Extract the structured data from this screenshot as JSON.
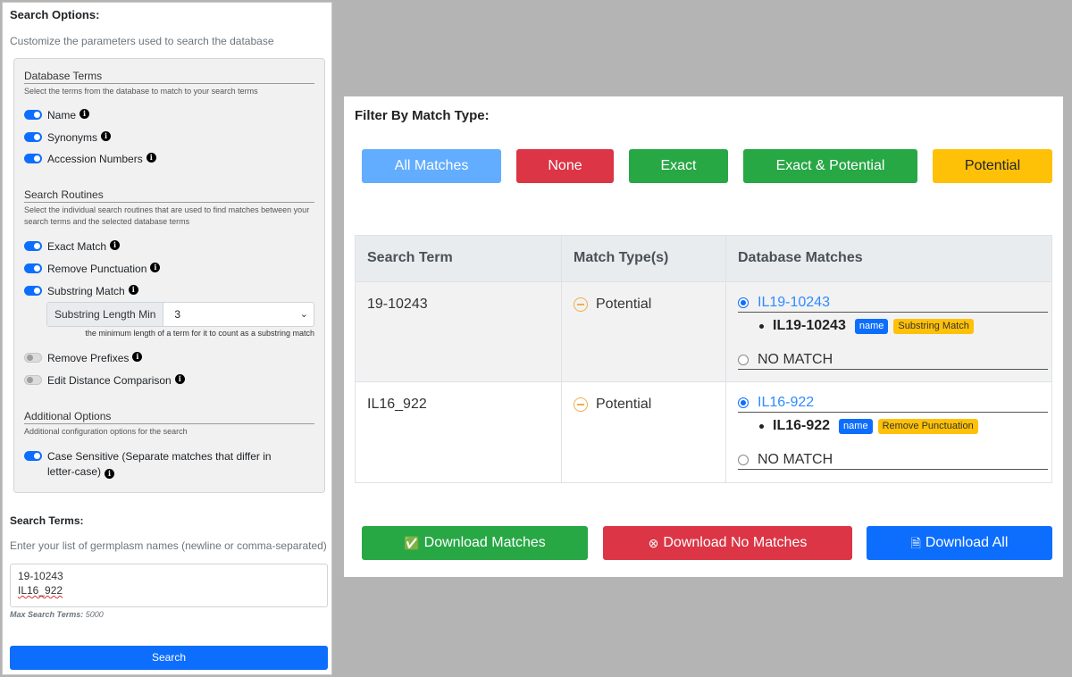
{
  "search_options": {
    "title": "Search Options:",
    "subtitle": "Customize the parameters used to search the database",
    "database_terms": {
      "heading": "Database Terms",
      "description": "Select the terms from the database to match to your search terms",
      "options": [
        {
          "label": "Name",
          "enabled": true
        },
        {
          "label": "Synonyms",
          "enabled": true
        },
        {
          "label": "Accession Numbers",
          "enabled": true
        }
      ]
    },
    "search_routines": {
      "heading": "Search Routines",
      "description": "Select the individual search routines that are used to find matches between your search terms and the selected database terms",
      "options": [
        {
          "label": "Exact Match",
          "enabled": true
        },
        {
          "label": "Remove Punctuation",
          "enabled": true
        },
        {
          "label": "Substring Match",
          "enabled": true
        },
        {
          "label": "Remove Prefixes",
          "enabled": false
        },
        {
          "label": "Edit Distance Comparison",
          "enabled": false
        }
      ],
      "substring_length": {
        "label": "Substring Length Min",
        "value": "3",
        "hint": "the minimum length of a term for it to count as a substring match"
      }
    },
    "additional_options": {
      "heading": "Additional Options",
      "description": "Additional configuration options for the search",
      "options": [
        {
          "label": "Case Sensitive (Separate matches that differ in letter-case)",
          "enabled": true
        }
      ]
    }
  },
  "search_terms": {
    "title": "Search Terms:",
    "subtitle": "Enter your list of germplasm names (newline or comma-separated)",
    "lines": [
      "19-10243",
      "IL16_922"
    ],
    "max_label": "Max Search Terms:",
    "max_value": "5000",
    "search_button": "Search"
  },
  "filter": {
    "title": "Filter By Match Type:",
    "buttons": [
      "All Matches",
      "None",
      "Exact",
      "Exact & Potential",
      "Potential"
    ]
  },
  "results": {
    "headers": [
      "Search Term",
      "Match Type(s)",
      "Database Matches"
    ],
    "rows": [
      {
        "term": "19-10243",
        "match_type": "Potential",
        "match_link": "IL19-10243",
        "detail_name": "IL19-10243",
        "badge_term": "name",
        "badge_routine": "Substring Match",
        "no_match": "NO MATCH"
      },
      {
        "term": "IL16_922",
        "match_type": "Potential",
        "match_link": "IL16-922",
        "detail_name": "IL16-922",
        "badge_term": "name",
        "badge_routine": "Remove Punctuation",
        "no_match": "NO MATCH"
      }
    ]
  },
  "downloads": {
    "matches": "Download Matches",
    "no_matches": "Download No Matches",
    "all": "Download All"
  },
  "colors": {
    "primary": "#0d6efd",
    "success": "#28a745",
    "danger": "#dc3545",
    "warning": "#ffc107",
    "light_primary": "#62adff"
  },
  "icons": [
    "info-icon",
    "toggle-switch",
    "chevron-down-icon",
    "minus-circle-icon",
    "radio-button",
    "check-circle-icon",
    "x-circle-icon",
    "file-icon"
  ]
}
